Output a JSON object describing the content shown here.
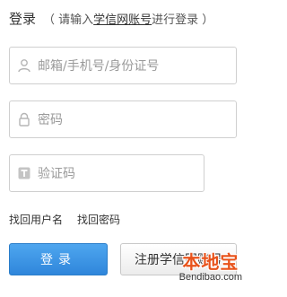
{
  "header": {
    "title": "登录",
    "subtitle_prefix": "（ 请输入",
    "subtitle_link": "学信网账号",
    "subtitle_suffix": "进行登录 ）"
  },
  "form": {
    "username_placeholder": "邮箱/手机号/身份证号",
    "password_placeholder": "密码",
    "captcha_placeholder": "验证码"
  },
  "links": {
    "find_username": "找回用户名",
    "find_password": "找回密码"
  },
  "buttons": {
    "login": "登录",
    "register": "注册学信网账号"
  },
  "watermark": {
    "brand": "本地宝",
    "domain": "Bendibao.com"
  },
  "colors": {
    "login_button": "#2f86db",
    "watermark": "#e8531b"
  }
}
